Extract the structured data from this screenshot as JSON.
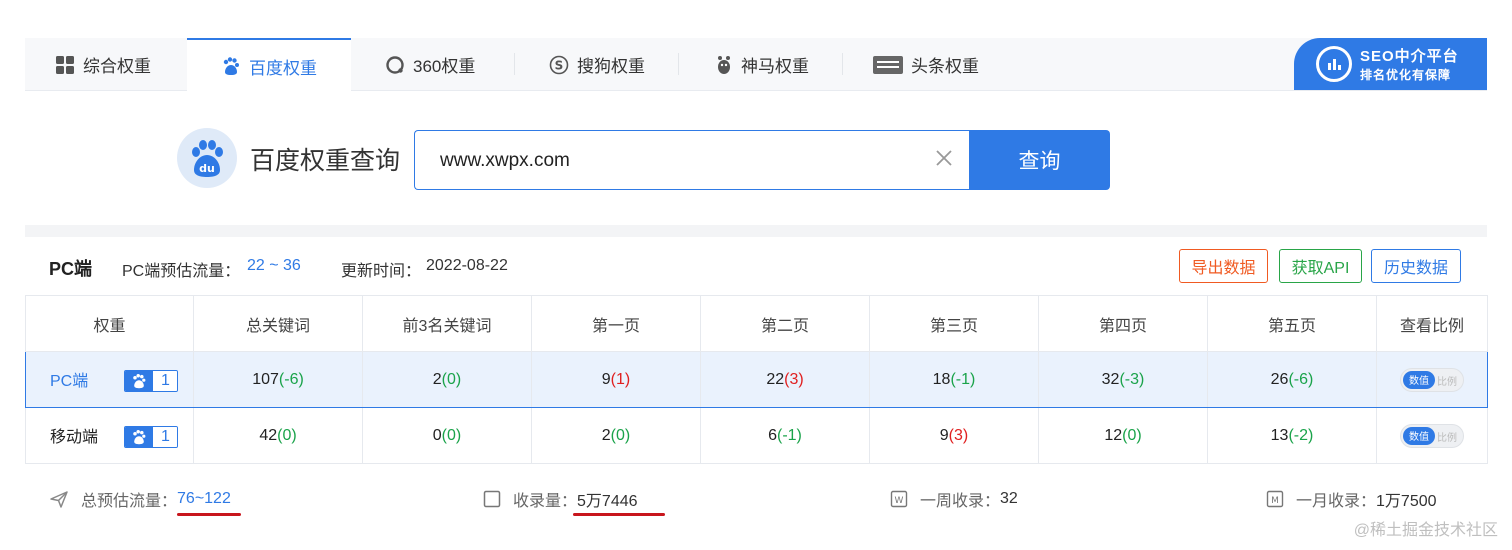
{
  "tabs": [
    {
      "label": "综合权重",
      "icon": "grid-icon"
    },
    {
      "label": "百度权重",
      "icon": "baidu-paw-icon",
      "active": true
    },
    {
      "label": "360权重",
      "icon": "360-icon"
    },
    {
      "label": "搜狗权重",
      "icon": "sogou-icon"
    },
    {
      "label": "神马权重",
      "icon": "shenma-icon"
    },
    {
      "label": "头条权重",
      "icon": "toutiao-icon"
    }
  ],
  "seo_badge": {
    "title": "SEO中介平台",
    "subtitle": "排名优化有保障"
  },
  "search": {
    "title": "百度权重查询",
    "value": "www.xwpx.com",
    "button": "查询"
  },
  "summary": {
    "platform": "PC端",
    "flow_label": "PC端预估流量：",
    "flow_value": "22 ~ 36",
    "update_label": "更新时间：",
    "update_value": "2022-08-22",
    "buttons": {
      "export": "导出数据",
      "api": "获取API",
      "history": "历史数据"
    }
  },
  "table": {
    "headers": [
      "权重",
      "总关键词",
      "前3名关键词",
      "第一页",
      "第二页",
      "第三页",
      "第四页",
      "第五页",
      "查看比例"
    ],
    "rows": [
      {
        "name": "PC端",
        "weight": "1",
        "cells": [
          {
            "value": "107",
            "delta": "(-6)",
            "trend": "down"
          },
          {
            "value": "2",
            "delta": "(0)",
            "trend": "zero"
          },
          {
            "value": "9",
            "delta": "(1)",
            "trend": "up"
          },
          {
            "value": "22",
            "delta": "(3)",
            "trend": "up"
          },
          {
            "value": "18",
            "delta": "(-1)",
            "trend": "down"
          },
          {
            "value": "32",
            "delta": "(-3)",
            "trend": "down"
          },
          {
            "value": "26",
            "delta": "(-6)",
            "trend": "down"
          }
        ],
        "toggle": {
          "on": "数值",
          "off": "比例"
        }
      },
      {
        "name": "移动端",
        "weight": "1",
        "cells": [
          {
            "value": "42",
            "delta": "(0)",
            "trend": "zero"
          },
          {
            "value": "0",
            "delta": "(0)",
            "trend": "zero"
          },
          {
            "value": "2",
            "delta": "(0)",
            "trend": "zero"
          },
          {
            "value": "6",
            "delta": "(-1)",
            "trend": "down"
          },
          {
            "value": "9",
            "delta": "(3)",
            "trend": "up"
          },
          {
            "value": "12",
            "delta": "(0)",
            "trend": "zero"
          },
          {
            "value": "13",
            "delta": "(-2)",
            "trend": "down"
          }
        ],
        "toggle": {
          "on": "数值",
          "off": "比例"
        }
      }
    ]
  },
  "footer": {
    "total_flow_label": "总预估流量：",
    "total_flow_value": "76~122",
    "indexed_label": "收录量：",
    "indexed_value": "5万7446",
    "week_label": "一周收录：",
    "week_value": "32",
    "month_label": "一月收录：",
    "month_value": "1万7500"
  },
  "watermark": "@稀土掘金技术社区",
  "colors": {
    "accent": "#2f7ae5",
    "up": "#e02020",
    "down": "#1aa34a",
    "export": "#f05a22",
    "api": "#29a548",
    "underline": "#c8161d"
  }
}
